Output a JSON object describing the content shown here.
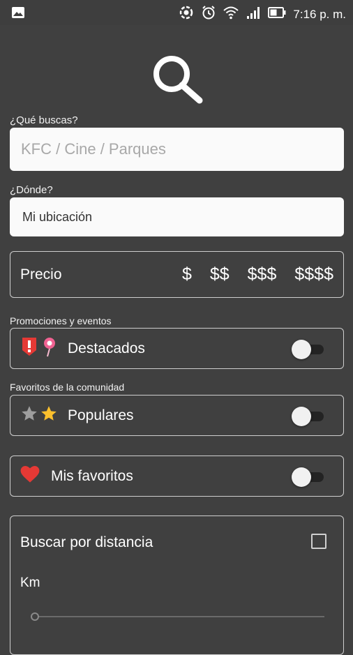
{
  "status_bar": {
    "time": "7:16 p. m."
  },
  "search": {
    "what_label": "¿Qué buscas?",
    "what_placeholder": "KFC / Cine / Parques",
    "where_label": "¿Dónde?",
    "where_value": "Mi ubicación"
  },
  "price": {
    "label": "Precio",
    "options": [
      "$",
      "$$",
      "$$$",
      "$$$$"
    ]
  },
  "promotions": {
    "section_label": "Promociones y eventos",
    "label": "Destacados",
    "enabled": false
  },
  "community": {
    "section_label": "Favoritos de la comunidad",
    "label": "Populares",
    "enabled": false
  },
  "favorites": {
    "label": "Mis favoritos",
    "enabled": false
  },
  "distance": {
    "label": "Buscar por distancia",
    "checked": false,
    "unit_label": "Km"
  },
  "colors": {
    "background": "#404040",
    "heart": "#e53935",
    "star": "#fbc02d",
    "alert": "#e53935",
    "pin": "#f06292"
  }
}
